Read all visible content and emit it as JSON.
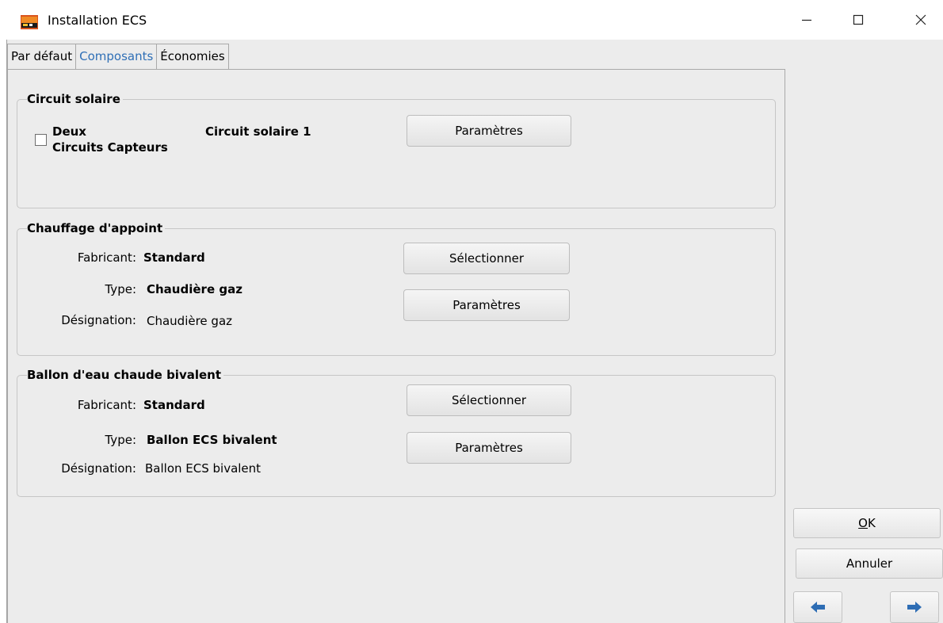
{
  "window": {
    "title": "Installation ECS",
    "minimize_glyph": "—",
    "maximize_glyph": "☐",
    "close_glyph": "✕"
  },
  "tabs": [
    {
      "label": "Par défaut",
      "active": false
    },
    {
      "label": "Composants",
      "active": true
    },
    {
      "label": "Économies",
      "active": false
    }
  ],
  "solar": {
    "title": "Circuit solaire",
    "checkbox_label_line1": "Deux",
    "checkbox_label_line2": "Circuits Capteurs",
    "checkbox_checked": false,
    "circuit_name": "Circuit solaire 1",
    "params_button": "Paramètres"
  },
  "backup_heating": {
    "title": "Chauffage d'appoint",
    "manufacturer_label": "Fabricant:",
    "manufacturer_value": "Standard",
    "type_label": "Type:",
    "type_value": "Chaudière gaz",
    "designation_label": "Désignation:",
    "designation_value": "Chaudière gaz",
    "select_button": "Sélectionner",
    "params_button": "Paramètres"
  },
  "tank": {
    "title": "Ballon d'eau chaude bivalent",
    "manufacturer_label": "Fabricant:",
    "manufacturer_value": "Standard",
    "type_label": "Type:",
    "type_value": "Ballon ECS bivalent",
    "designation_label": "Désignation:",
    "designation_value": "Ballon ECS bivalent",
    "select_button": "Sélectionner",
    "params_button": "Paramètres"
  },
  "actions": {
    "ok_first": "O",
    "ok_rest": "K",
    "cancel": "Annuler",
    "back_icon": "arrow-left-icon",
    "forward_icon": "arrow-right-icon"
  },
  "colors": {
    "active_tab": "#2f6fb6",
    "arrow": "#2e6db4",
    "dialog_bg": "#ececec"
  }
}
